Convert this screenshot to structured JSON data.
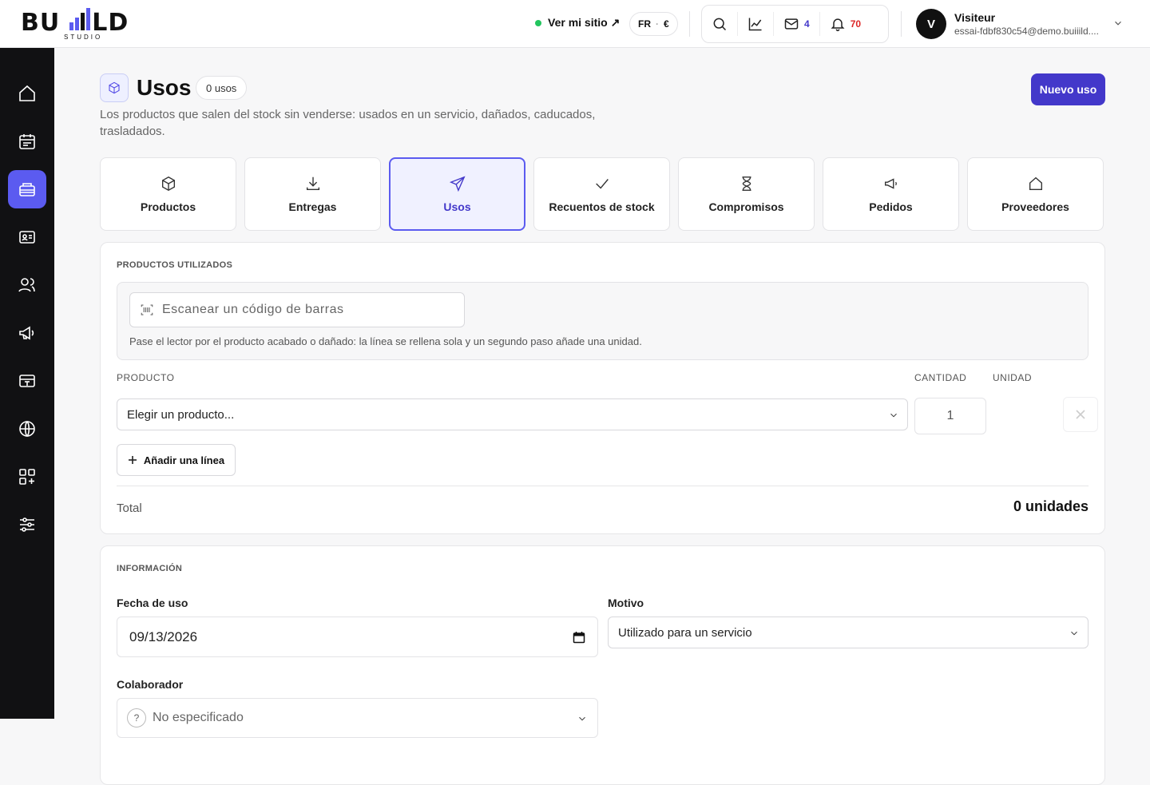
{
  "brand": {
    "logo_text": "BU  LD",
    "logo_sub": "STUDIO"
  },
  "header": {
    "site_link": "Ver mi sitio ↗",
    "locale": {
      "lang": "FR",
      "sep": "·",
      "currency": "€"
    },
    "tools": {
      "messages_count": "4",
      "notifications_count": "70"
    },
    "user": {
      "initial": "V",
      "name": "Visiteur",
      "email": "essai-fdbf830c54@demo.buiiild...."
    }
  },
  "sidebar": {
    "items": [
      {
        "icon": "home-icon"
      },
      {
        "icon": "calendar-icon"
      },
      {
        "icon": "inventory-icon",
        "active": true
      },
      {
        "icon": "contact-card-icon"
      },
      {
        "icon": "users-icon"
      },
      {
        "icon": "megaphone-icon"
      },
      {
        "icon": "cash-register-icon"
      },
      {
        "icon": "globe-icon"
      },
      {
        "icon": "apps-icon"
      },
      {
        "icon": "settings-sliders-icon"
      }
    ]
  },
  "page": {
    "title": "Usos",
    "count_badge": "0 usos",
    "description": "Los productos que salen del stock sin venderse: usados en un servicio, dañados, caducados, trasladados.",
    "new_button": "Nuevo uso"
  },
  "tabs": [
    {
      "label": "Productos",
      "icon": "box-icon"
    },
    {
      "label": "Entregas",
      "icon": "download-icon"
    },
    {
      "label": "Usos",
      "icon": "send-icon",
      "active": true
    },
    {
      "label": "Recuentos de stock",
      "icon": "check-icon"
    },
    {
      "label": "Compromisos",
      "icon": "hourglass-icon"
    },
    {
      "label": "Pedidos",
      "icon": "megaphone-icon"
    },
    {
      "label": "Proveedores",
      "icon": "home-icon"
    }
  ],
  "products_section": {
    "label": "PRODUCTOS UTILIZADOS",
    "scan_placeholder": "Escanear un código de barras",
    "scan_hint": "Pase el lector por el producto acabado o dañado: la línea se rellena sola y un segundo paso añade una unidad.",
    "col_product": "PRODUCTO",
    "col_qty": "CANTIDAD",
    "col_unit": "UNIDAD",
    "product_select": "Elegir un producto...",
    "qty_value": "1",
    "add_line": "Añadir una línea",
    "total_label": "Total",
    "total_value": "0 unidades"
  },
  "info_section": {
    "label": "INFORMACIÓN",
    "date_label": "Fecha de uso",
    "date_value": "09/13/2026",
    "reason_label": "Motivo",
    "reason_value": "Utilizado para un servicio",
    "collab_label": "Colaborador",
    "collab_icon_text": "?",
    "collab_value": "No especificado"
  },
  "colors": {
    "accent": "#4338ca",
    "accent_light": "#5b5bf0",
    "sidebar_bg": "#111113",
    "status_online": "#22c55e",
    "notif_red": "#dc2626"
  }
}
